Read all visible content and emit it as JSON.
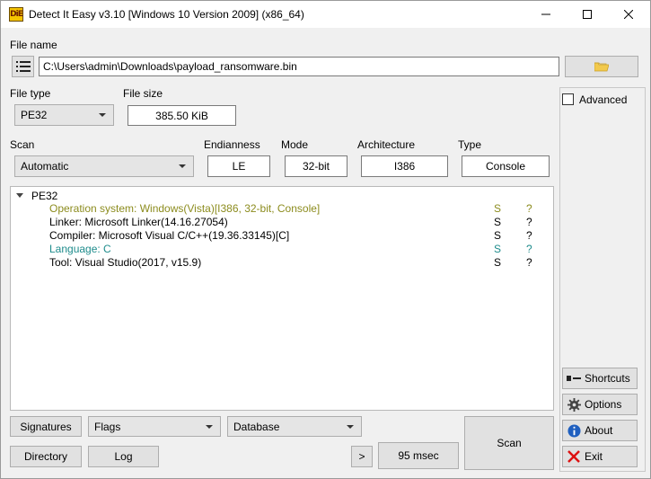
{
  "window": {
    "title": "Detect It Easy v3.10 [Windows 10 Version 2009] (x86_64)",
    "icon_text": "DiE"
  },
  "file": {
    "label": "File name",
    "path": "C:\\Users\\admin\\Downloads\\payload_ransomware.bin"
  },
  "file_type": {
    "label": "File type",
    "value": "PE32"
  },
  "file_size": {
    "label": "File size",
    "value": "385.50 KiB"
  },
  "scan": {
    "label": "Scan",
    "value": "Automatic"
  },
  "endianness": {
    "label": "Endianness",
    "value": "LE"
  },
  "mode": {
    "label": "Mode",
    "value": "32-bit"
  },
  "architecture": {
    "label": "Architecture",
    "value": "I386"
  },
  "type": {
    "label": "Type",
    "value": "Console"
  },
  "results": {
    "root": "PE32",
    "rows": [
      {
        "name": "Operation system: Windows(Vista)[I386, 32-bit, Console]",
        "s": "S",
        "q": "?",
        "color": "#8c8c1e"
      },
      {
        "name": "Linker: Microsoft Linker(14.16.27054)",
        "s": "S",
        "q": "?",
        "color": "#000000"
      },
      {
        "name": "Compiler: Microsoft Visual C/C++(19.36.33145)[C]",
        "s": "S",
        "q": "?",
        "color": "#000000"
      },
      {
        "name": "Language: C",
        "s": "S",
        "q": "?",
        "color": "#1e8c8c"
      },
      {
        "name": "Tool: Visual Studio(2017, v15.9)",
        "s": "S",
        "q": "?",
        "color": "#000000"
      }
    ]
  },
  "side": {
    "advanced": "Advanced",
    "shortcuts": "Shortcuts",
    "options": "Options",
    "about": "About",
    "exit": "Exit"
  },
  "bottom": {
    "signatures": "Signatures",
    "flags": "Flags",
    "database": "Database",
    "directory": "Directory",
    "log": "Log",
    "more": ">",
    "time": "95 msec",
    "scan": "Scan"
  }
}
